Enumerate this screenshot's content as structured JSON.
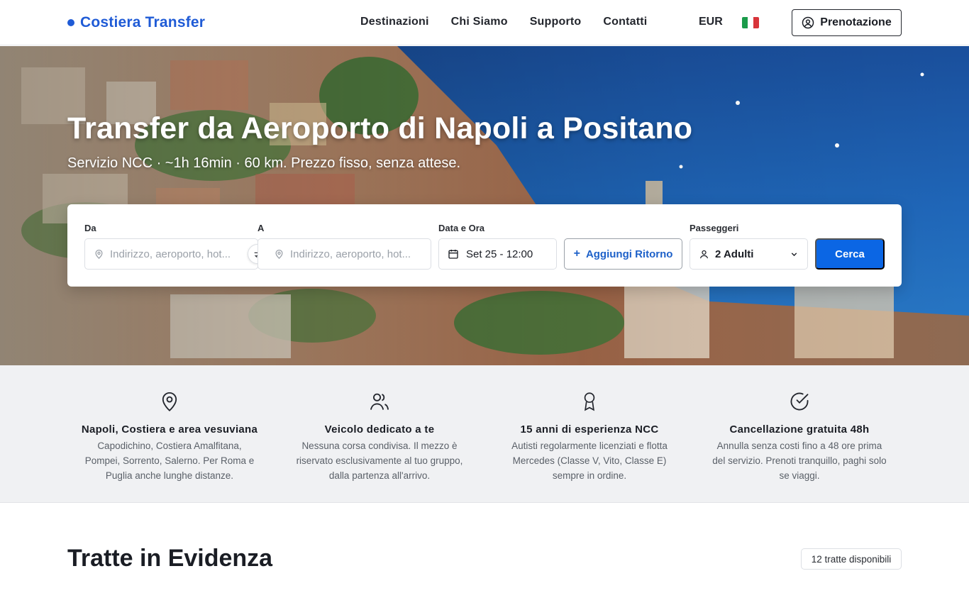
{
  "header": {
    "brand": "Costiera Transfer",
    "nav": [
      "Destinazioni",
      "Chi Siamo",
      "Supporto",
      "Contatti"
    ],
    "currency": "EUR",
    "language_flag": "italy-flag-icon",
    "booking_label": "Prenotazione",
    "accent_color": "#1f5bd6"
  },
  "hero": {
    "title": "Transfer da Aeroporto di Napoli a Positano",
    "subtitle": "Servizio NCC · ~1h 16min · 60 km. Prezzo fisso, senza attese."
  },
  "search": {
    "from_label": "Da",
    "from_placeholder": "Indirizzo, aeroporto, hot...",
    "to_label": "A",
    "to_placeholder": "Indirizzo, aeroporto, hot...",
    "date_label": "Data e Ora",
    "date_value": "Set 25 - 12:00",
    "return_label": "Aggiungi Ritorno",
    "passengers_label": "Passeggeri",
    "passengers_value": "2 Adulti",
    "search_label": "Cerca",
    "primary_color": "#0b66e4"
  },
  "features": [
    {
      "icon": "map-pin-icon",
      "title": "Napoli, Costiera e area vesuviana",
      "desc": "Capodichino, Costiera Amalfitana, Pompei, Sorrento, Salerno. Per Roma e Puglia anche lunghe distanze."
    },
    {
      "icon": "users-icon",
      "title": "Veicolo dedicato a te",
      "desc": "Nessuna corsa condivisa. Il mezzo è riservato esclusivamente al tuo gruppo, dalla partenza all'arrivo."
    },
    {
      "icon": "award-icon",
      "title": "15 anni di esperienza NCC",
      "desc": "Autisti regolarmente licenziati e flotta Mercedes (Classe V, Vito, Classe E) sempre in ordine."
    },
    {
      "icon": "check-circle-icon",
      "title": "Cancellazione gratuita 48h",
      "desc": "Annulla senza costi fino a 48 ore prima del servizio. Prenoti tranquillo, paghi solo se viaggi."
    }
  ],
  "featured": {
    "title": "Tratte in Evidenza",
    "badge": "12 tratte disponibili"
  }
}
